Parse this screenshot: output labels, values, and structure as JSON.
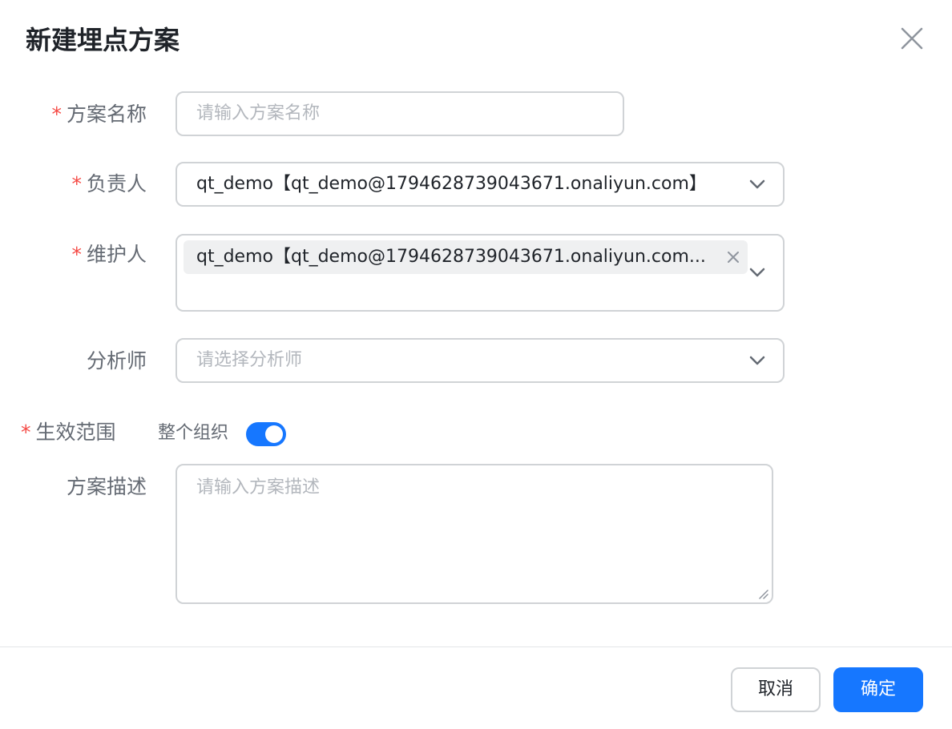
{
  "dialog": {
    "title": "新建埋点方案",
    "close_icon": "close-icon"
  },
  "form": {
    "scheme_name": {
      "label": "方案名称",
      "required_mark": "*",
      "placeholder": "请输入方案名称",
      "value": ""
    },
    "owner": {
      "label": "负责人",
      "required_mark": "*",
      "value": "qt_demo【qt_demo@1794628739043671.onaliyun.com】"
    },
    "maintainer": {
      "label": "维护人",
      "required_mark": "*",
      "tags": [
        "qt_demo【qt_demo@1794628739043671.onaliyun.com..."
      ]
    },
    "analyst": {
      "label": "分析师",
      "placeholder": "请选择分析师"
    },
    "scope": {
      "label": "生效范围",
      "required_mark": "*",
      "switch_label": "整个组织",
      "switch_on": true
    },
    "description": {
      "label": "方案描述",
      "placeholder": "请输入方案描述",
      "value": ""
    }
  },
  "footer": {
    "cancel_label": "取消",
    "ok_label": "确定"
  },
  "colors": {
    "primary": "#1677ff",
    "required": "#f54a45",
    "label": "#646a73",
    "border": "#d0d3d6"
  }
}
